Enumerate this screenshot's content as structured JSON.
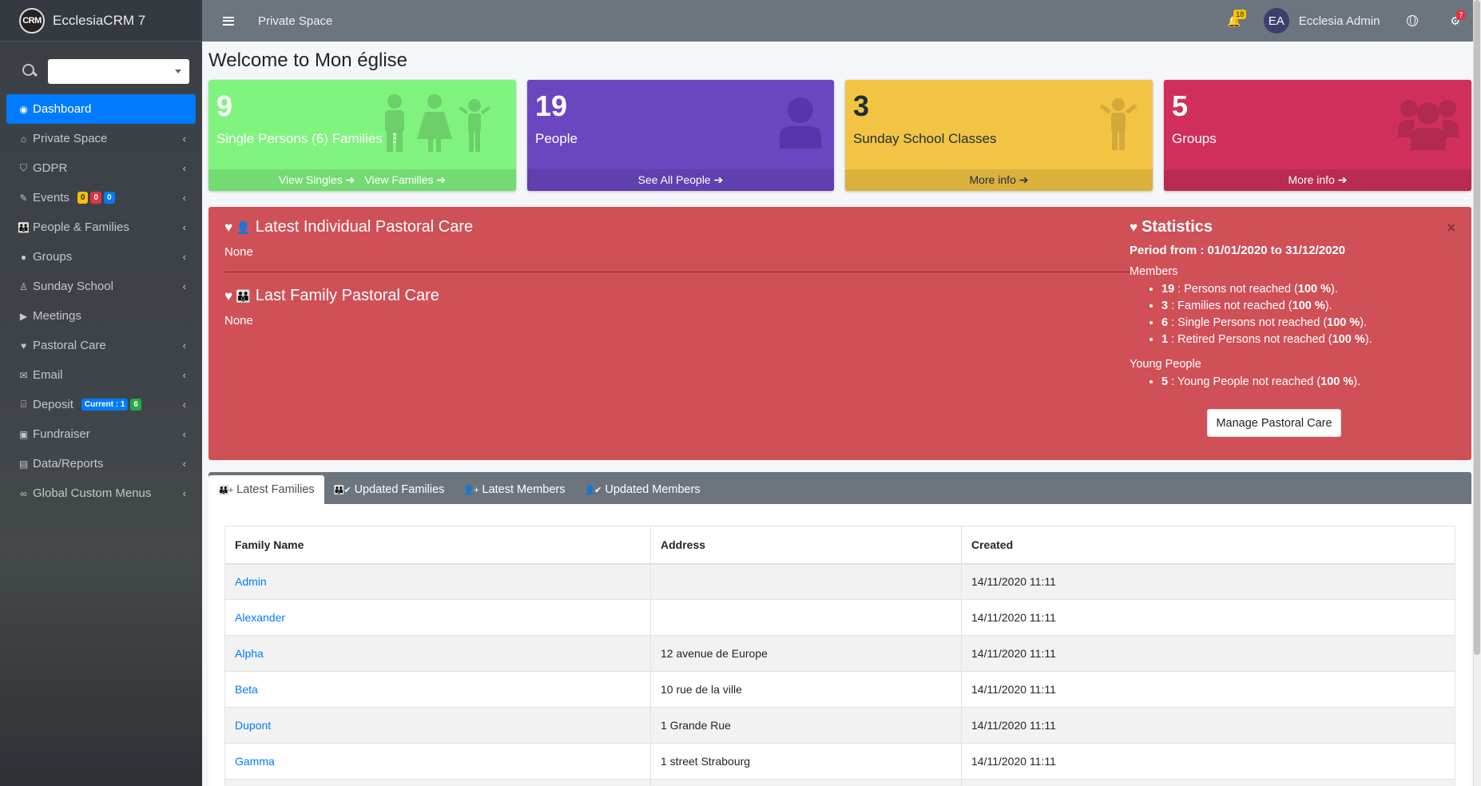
{
  "app": {
    "brand_logo": "CRM",
    "brand_name": "EcclesiaCRM 7"
  },
  "sidebar": {
    "items": [
      {
        "label": "Dashboard",
        "icon": "dashboard-icon",
        "glyph": "◉",
        "active": true,
        "caret": false
      },
      {
        "label": "Private Space",
        "icon": "home-icon",
        "glyph": "⌂",
        "caret": true
      },
      {
        "label": "GDPR",
        "icon": "shield-icon",
        "glyph": "⛉",
        "caret": true
      },
      {
        "label": "Events",
        "icon": "ticket-icon",
        "glyph": "✎",
        "caret": true,
        "badges": [
          {
            "text": "0",
            "color": "#ffc107",
            "fg": "#1f2d3d"
          },
          {
            "text": "0",
            "color": "#dc3545",
            "fg": "#fff"
          },
          {
            "text": "0",
            "color": "#007bff",
            "fg": "#fff"
          }
        ]
      },
      {
        "label": "People & Families",
        "icon": "family-icon",
        "glyph": "👪",
        "caret": true
      },
      {
        "label": "Groups",
        "icon": "users-icon",
        "glyph": "●",
        "caret": true
      },
      {
        "label": "Sunday School",
        "icon": "child-icon",
        "glyph": "♙",
        "caret": true
      },
      {
        "label": "Meetings",
        "icon": "video-icon",
        "glyph": "▶",
        "caret": false
      },
      {
        "label": "Pastoral Care",
        "icon": "heartbeat-icon",
        "glyph": "♥",
        "caret": true
      },
      {
        "label": "Email",
        "icon": "envelope-icon",
        "glyph": "✉",
        "caret": true
      },
      {
        "label": "Deposit",
        "icon": "bank-icon",
        "glyph": "⌸",
        "caret": true,
        "badges": [
          {
            "text": "Current : 1",
            "color": "#007bff",
            "fg": "#fff"
          },
          {
            "text": "6",
            "color": "#28a745",
            "fg": "#fff"
          }
        ]
      },
      {
        "label": "Fundraiser",
        "icon": "money-icon",
        "glyph": "▣",
        "caret": true
      },
      {
        "label": "Data/Reports",
        "icon": "file-pdf-icon",
        "glyph": "▤",
        "caret": true
      },
      {
        "label": "Global Custom Menus",
        "icon": "link-icon",
        "glyph": "∞",
        "caret": true
      }
    ]
  },
  "topbar": {
    "title": "Private Space",
    "notif_count": "18",
    "avatar_initials": "EA",
    "username": "Ecclesia Admin",
    "settings_count": "7"
  },
  "page": {
    "title": "Welcome to Mon église"
  },
  "boxes": [
    {
      "number": "9",
      "label": "Single Persons (6) Families (3)",
      "color": "#80f37e",
      "footer_color": "#73db71",
      "links": [
        "View Singles ➔",
        "View Familles ➔"
      ]
    },
    {
      "number": "19",
      "label": "People",
      "color": "#6b46c1",
      "footer_color": "#603fae",
      "links": [
        "See All People ➔"
      ]
    },
    {
      "number": "3",
      "label": "Sunday School Classes",
      "color": "#f3c443",
      "footer_color": "#dbb03c",
      "links": [
        "More info ➔"
      ]
    },
    {
      "number": "5",
      "label": "Groups",
      "color": "#d02f5c",
      "footer_color": "#bb2a53",
      "links": [
        "More info ➔"
      ]
    }
  ],
  "pastoral": {
    "individual_title": "Latest Individual Pastoral Care",
    "individual_text": "None",
    "family_title": "Last Family Pastoral Care",
    "family_text": "None",
    "stats_title": "Statistics",
    "period": "Period from : 01/01/2020 to 31/12/2020",
    "members_label": "Members",
    "members": [
      {
        "count": "19",
        "text": " : Persons not reached (",
        "pct": "100 %",
        "end": ")."
      },
      {
        "count": "3",
        "text": " : Families not reached (",
        "pct": "100 %",
        "end": ")."
      },
      {
        "count": "6",
        "text": " : Single Persons not reached (",
        "pct": "100 %",
        "end": ")."
      },
      {
        "count": "1",
        "text": " : Retired Persons not reached (",
        "pct": "100 %",
        "end": ")."
      }
    ],
    "young_label": "Young People",
    "young": [
      {
        "count": "5",
        "text": " : Young People not reached (",
        "pct": "100 %",
        "end": ")."
      }
    ],
    "manage_button": "Manage Pastoral Care",
    "close": "×"
  },
  "tabs": [
    {
      "label": "Latest Families",
      "glyph": "👪+",
      "icon": "family-plus-icon",
      "active": true
    },
    {
      "label": "Updated Families",
      "glyph": "👪✔",
      "icon": "family-check-icon",
      "active": false
    },
    {
      "label": "Latest Members",
      "glyph": "👤+",
      "icon": "user-plus-icon",
      "active": false
    },
    {
      "label": "Updated Members",
      "glyph": "👤✔",
      "icon": "user-check-icon",
      "active": false
    }
  ],
  "table": {
    "headers": [
      "Family Name",
      "Address",
      "Created"
    ],
    "rows": [
      {
        "name": "Admin",
        "address": "",
        "created": "14/11/2020 11:11"
      },
      {
        "name": "Alexander",
        "address": "",
        "created": "14/11/2020 11:11"
      },
      {
        "name": "Alpha",
        "address": "12 avenue de Europe",
        "created": "14/11/2020 11:11"
      },
      {
        "name": "Beta",
        "address": "10 rue de la ville",
        "created": "14/11/2020 11:11"
      },
      {
        "name": "Dupont",
        "address": "1 Grande Rue",
        "created": "14/11/2020 11:11"
      },
      {
        "name": "Gamma",
        "address": "1 street Strabourg",
        "created": "14/11/2020 11:11"
      },
      {
        "name": "",
        "address": "",
        "created": ""
      }
    ]
  }
}
